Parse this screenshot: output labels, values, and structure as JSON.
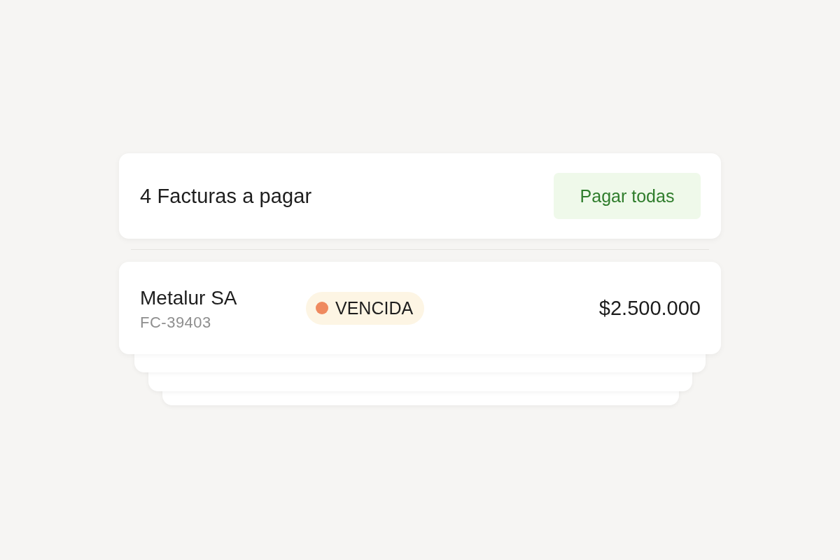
{
  "header": {
    "title": "4 Facturas a pagar",
    "button": "Pagar todas"
  },
  "invoice": {
    "company": "Metalur SA",
    "number": "FC-39403",
    "status": {
      "label": "VENCIDA",
      "color": "#ef8a5f"
    },
    "amount": "$2.500.000"
  }
}
